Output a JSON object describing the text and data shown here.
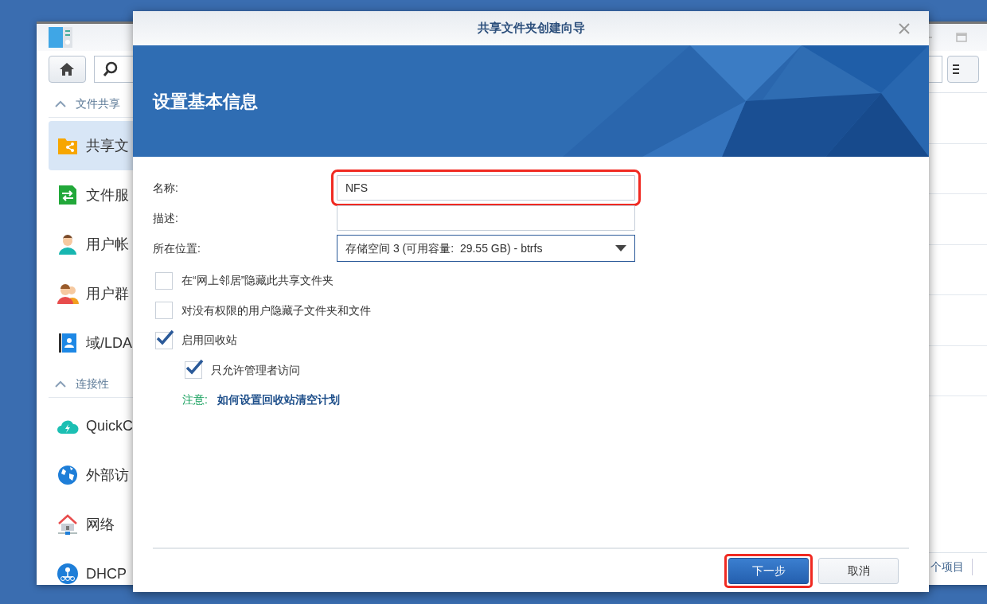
{
  "back_window": {
    "sidebar": {
      "sections": [
        {
          "title": "文件共享",
          "expanded": true,
          "items": [
            {
              "label": "共享文",
              "selected": true
            },
            {
              "label": "文件服",
              "selected": false
            },
            {
              "label": "用户帐",
              "selected": false
            },
            {
              "label": "用户群",
              "selected": false
            },
            {
              "label": "域/LDA",
              "selected": false
            }
          ]
        },
        {
          "title": "连接性",
          "expanded": true,
          "items": [
            {
              "label": "QuickC",
              "selected": false
            },
            {
              "label": "外部访",
              "selected": false
            },
            {
              "label": "网络",
              "selected": false
            },
            {
              "label": "DHCP",
              "selected": false
            }
          ]
        }
      ]
    },
    "status_bar": {
      "count_text": "个项目"
    }
  },
  "dialog": {
    "title": "共享文件夹创建向导",
    "heading": "设置基本信息",
    "fields": [
      {
        "kind": "text",
        "label": "名称:",
        "value": "NFS",
        "highlighted": true
      },
      {
        "kind": "text",
        "label": "描述:",
        "highlighted": false
      },
      {
        "kind": "select",
        "label": "所在位置:",
        "value": "存储空间 3 (可用容量:  29.55 GB) - btrfs",
        "highlighted": false
      }
    ],
    "checkboxes": [
      {
        "label": "在“网上邻居”隐藏此共享文件夹",
        "checked": false
      },
      {
        "label": "对没有权限的用户隐藏子文件夹和文件",
        "checked": false
      },
      {
        "label": "启用回收站",
        "checked": true,
        "children": [
          {
            "label": "只允许管理者访问",
            "checked": true
          }
        ]
      }
    ],
    "note": {
      "label": "注意:",
      "link": "如何设置回收站清空计划"
    },
    "buttons": [
      {
        "label": "下一步",
        "kind": "primary",
        "highlighted": true
      },
      {
        "label": "取消",
        "kind": "secondary",
        "highlighted": false
      }
    ]
  }
}
